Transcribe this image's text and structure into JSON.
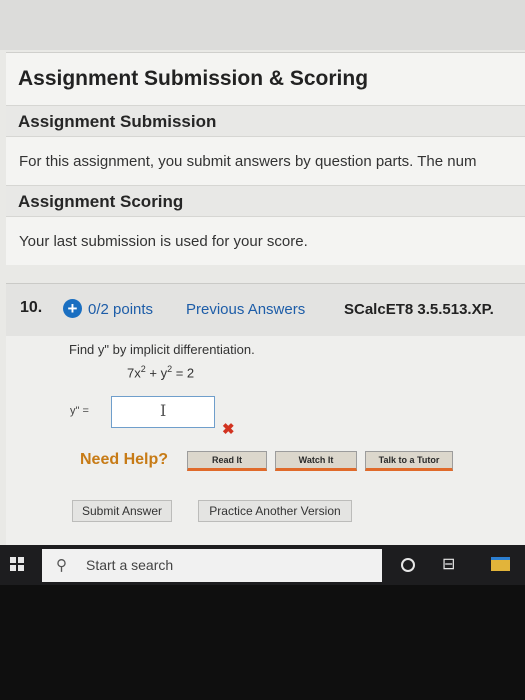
{
  "panel": {
    "title": "Assignment Submission & Scoring",
    "submission_heading": "Assignment Submission",
    "submission_text": "For this assignment, you submit answers by question parts. The num",
    "scoring_heading": "Assignment Scoring",
    "scoring_text": "Your last submission is used for your score."
  },
  "question": {
    "number": "10.",
    "points": "0/2 points",
    "previous_answers": "Previous Answers",
    "source": "SCalcET8 3.5.513.XP.",
    "prompt": "Find  y\"  by implicit differentiation.",
    "eq_part1": "7x",
    "eq_exp1": "2",
    "eq_part2": " + y",
    "eq_exp2": "2",
    "eq_part3": " = 2",
    "answer_label": "y\" =",
    "answer_value": "",
    "cursor_glyph": "I",
    "status_mark": "✖"
  },
  "help": {
    "label": "Need Help?",
    "read_it": "Read It",
    "watch_it": "Watch It",
    "talk_to_tutor": "Talk to a Tutor"
  },
  "actions": {
    "submit": "Submit Answer",
    "practice": "Practice Another Version"
  },
  "taskbar": {
    "search_placeholder": "Start a search",
    "search_glyph": "⚲",
    "taskview_glyph": "⊟"
  },
  "colors": {
    "link": "#1d5da8",
    "need_help": "#c77b16",
    "incorrect": "#d23320",
    "help_button_accent": "#e06a2a"
  }
}
